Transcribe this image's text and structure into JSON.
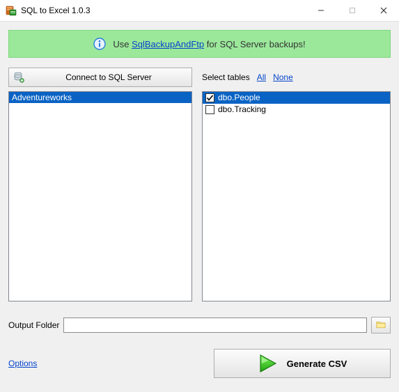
{
  "window": {
    "title": "SQL to Excel 1.0.3"
  },
  "banner": {
    "prefix": "Use ",
    "link_text": "SqlBackupAndFtp",
    "suffix": " for SQL Server backups!"
  },
  "connect_button_label": "Connect to SQL Server",
  "databases": {
    "items": [
      {
        "name": "Adventureworks",
        "selected": true
      }
    ]
  },
  "tables_section": {
    "label": "Select tables",
    "all_link": "All",
    "none_link": "None",
    "items": [
      {
        "name": "dbo.People",
        "checked": true,
        "selected": true
      },
      {
        "name": "dbo.Tracking",
        "checked": false,
        "selected": false
      }
    ]
  },
  "output": {
    "label": "Output Folder",
    "value": ""
  },
  "options_link": "Options",
  "generate_button_label": "Generate CSV",
  "colors": {
    "banner_bg": "#9be89b",
    "selection_bg": "#0a63c4",
    "link": "#0645cc",
    "play_fill": "#35c423"
  }
}
